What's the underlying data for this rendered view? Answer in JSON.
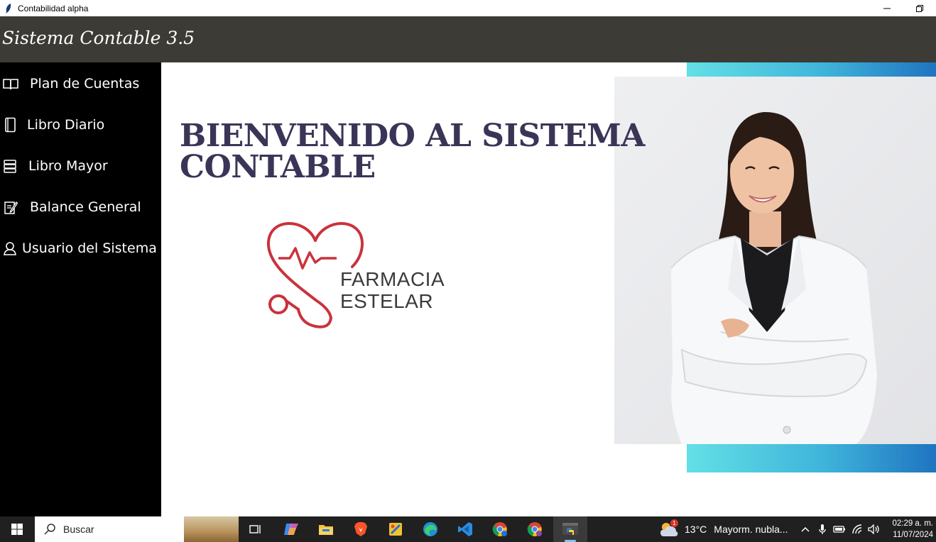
{
  "window": {
    "title": "Contabilidad alpha"
  },
  "header": {
    "title": "Sistema Contable 3.5"
  },
  "sidebar": {
    "items": [
      {
        "label": "Plan de Cuentas",
        "icon": "open-book-icon"
      },
      {
        "label": "Libro Diario",
        "icon": "notebook-icon"
      },
      {
        "label": "Libro Mayor",
        "icon": "ledger-stack-icon"
      },
      {
        "label": "Balance General",
        "icon": "edit-document-icon"
      },
      {
        "label": "Usuario del Sistema",
        "icon": "user-icon"
      }
    ]
  },
  "main": {
    "welcome_line1": "BIENVENIDO AL SISTEMA",
    "welcome_line2": "CONTABLE",
    "logo_line1": "FARMACIA",
    "logo_line2": "ESTELAR"
  },
  "taskbar": {
    "search_placeholder": "Buscar",
    "apps": [
      "task-view-icon",
      "copilot-icon",
      "file-explorer-icon",
      "brave-browser-icon",
      "snip-tool-icon",
      "edge-browser-icon",
      "vscode-icon",
      "chrome-icon",
      "chrome-profile-icon",
      "python-app-icon"
    ],
    "weather_temp": "13°C",
    "weather_condition": "Mayorm. nubla...",
    "weather_badge": "1",
    "time": "02:29 a. m.",
    "date": "11/07/2024"
  },
  "colors": {
    "header_bg": "#3c3b35",
    "sidebar_bg": "#000000",
    "welcome_text": "#3a3557",
    "logo_red": "#c9333d",
    "accent_gradient_start": "#62e0e6",
    "accent_gradient_end": "#1f74c0"
  }
}
